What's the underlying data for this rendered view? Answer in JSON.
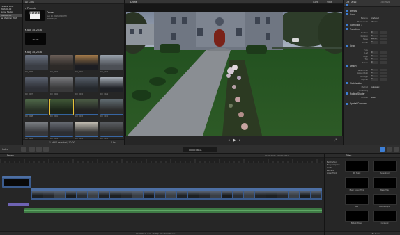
{
  "libraries": {
    "items": [
      {
        "label": "Timeline 2017"
      },
      {
        "label": "2016-08-13"
      },
      {
        "label": "Home Studio"
      },
      {
        "label": "2016-08-15"
      },
      {
        "label": "Ian Webinar 2016"
      }
    ]
  },
  "browser": {
    "filter_label": "All Clips",
    "projects_header": "Projects",
    "project_name": "Drone",
    "project_date": "Aug 15, 2016, 8:41 PM",
    "project_info": "00:00:48;02",
    "date_group_1": "Aug 15, 2016",
    "date_group_2": "Aug 15, 2016",
    "selection_status": "1 of 64 selected, 10:00",
    "duration_label": "2.6s",
    "clip_labels": [
      "DJI_0006",
      "DJI_0004",
      "DJI_0001",
      "DJI_0016",
      "DJI_0007",
      "DJI_0002",
      "DJI_0034",
      "DJI_0029",
      "DJI_0038",
      "DJI_0031",
      "DJI_0035",
      "DJI_0032",
      "DJI_0011",
      "DJI_0013",
      "DJI_0014",
      "DJI_0015"
    ]
  },
  "viewer": {
    "title": "Drone",
    "zoom": "53%",
    "view_label": "View",
    "timecode": "00:00:06:11"
  },
  "inspector": {
    "clip_name": "DJI_0016",
    "duration": "1:00:05:22",
    "sections": {
      "effects": "Effects",
      "color": "Color",
      "correction": "Correction 1",
      "transform": "Transform",
      "crop": "Crop",
      "distort": "Distort",
      "stabilization": "Stabilization",
      "rolling_shutter": "Rolling Shutter",
      "spatial_conform": "Spatial Conform"
    },
    "rows": {
      "balance": "Balance",
      "balance_value": "Analyzed",
      "match_color": "Match Color",
      "choose": "Choose...",
      "position": "Position",
      "rotation": "Rotation",
      "scale": "Scale",
      "anchor": "Anchor",
      "type": "Type",
      "trim": "Trim",
      "left": "Left",
      "right": "Right",
      "top": "Top",
      "bottom": "Bottom",
      "bottom_left": "Bottom Left",
      "bottom_right": "Bottom Right",
      "top_right": "Top Right",
      "top_left": "Top Left",
      "method": "Method",
      "method_value": "Automatic",
      "smoothing": "Smoothing",
      "amount": "Amount",
      "amount_value": "None",
      "zero": "0",
      "hundred": "100 %"
    }
  },
  "timeline": {
    "index_label": "Index",
    "project_label": "Drone",
    "range_label": "00:00:49:01 / 00:00:53:11",
    "footer_status": "00:00:53:11 total • 1080p HD 29.97 Stereo"
  },
  "titles_browser": {
    "header": "Titles",
    "categories": [
      "Build In/Out",
      "Bumper/Opener",
      "Credits",
      "Elements",
      "Lower Thirds"
    ],
    "items": [
      "3D Static",
      "Assembled",
      "Basic Lower Third",
      "Basic Title",
      "Blur",
      "Boogie Lights",
      "Bulletin Board",
      "Centered"
    ],
    "count_label": "183 items"
  },
  "colors": {
    "accent": "#3d7fd6",
    "clip_blue": "#3b5b8c",
    "audio_green": "#3f7a45",
    "title_purple": "#6e63b3"
  }
}
